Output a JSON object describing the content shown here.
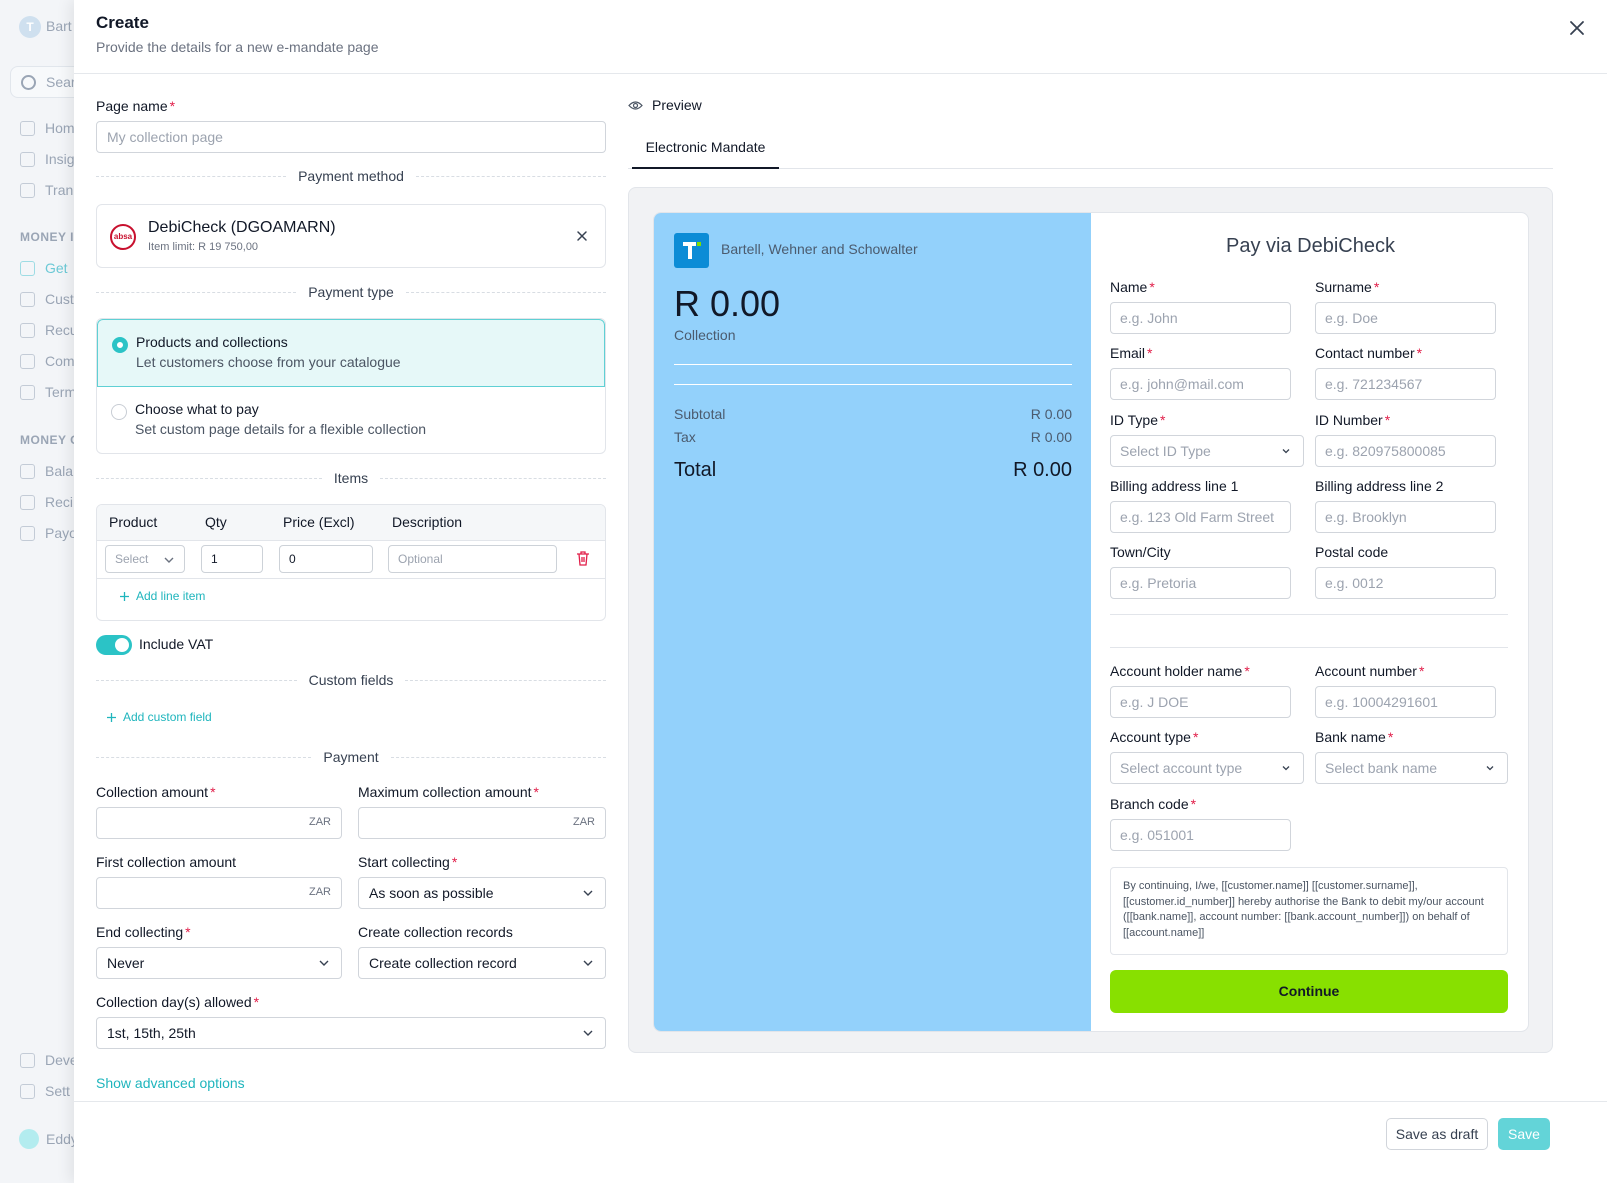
{
  "background": {
    "brand": "Bart",
    "search": "Sear",
    "items": [
      "Hom",
      "Insig",
      "Tran",
      "Get",
      "Cust",
      "Recu",
      "Com",
      "Term",
      "Bala",
      "Reci",
      "Payo",
      "Deve",
      "Sett"
    ],
    "sections": [
      "MONEY I",
      "MONEY O"
    ],
    "user": "Eddy"
  },
  "modal": {
    "title": "Create",
    "subtitle": "Provide the details for a new e-mandate page"
  },
  "form": {
    "page_name_label": "Page name",
    "page_name_placeholder": "My collection page",
    "payment_method_heading": "Payment method",
    "payment_method": {
      "logo_text": "absa",
      "name": "DebiCheck (DGOAMARN)",
      "limit": "Item limit: R 19 750,00"
    },
    "payment_type_heading": "Payment type",
    "payment_types": [
      {
        "title": "Products and collections",
        "desc": "Let customers choose from your catalogue",
        "selected": true
      },
      {
        "title": "Choose what to pay",
        "desc": "Set custom page details for a flexible collection",
        "selected": false
      }
    ],
    "items_heading": "Items",
    "items_columns": [
      "Product",
      "Qty",
      "Price (Excl)",
      "Description"
    ],
    "item_row": {
      "product": "Select",
      "qty": "1",
      "price": "0",
      "description": "Optional"
    },
    "add_line_item": "Add line item",
    "include_vat": "Include VAT",
    "custom_fields_heading": "Custom fields",
    "add_custom_field": "Add custom field",
    "payment_heading": "Payment",
    "collection_amount_label": "Collection amount",
    "max_collection_amount_label": "Maximum collection amount",
    "currency": "ZAR",
    "first_collection_amount_label": "First collection amount",
    "start_collecting_label": "Start collecting",
    "start_collecting_value": "As soon as possible",
    "end_collecting_label": "End collecting",
    "end_collecting_value": "Never",
    "create_records_label": "Create collection records",
    "create_records_value": "Create collection record",
    "collection_days_label": "Collection day(s) allowed",
    "collection_days_value": "1st, 15th, 25th",
    "advanced": "Show advanced options"
  },
  "preview": {
    "heading": "Preview",
    "tab": "Electronic Mandate",
    "merchant": "Bartell, Wehner and Schowalter",
    "amount": "R 0.00",
    "amount_caption": "Collection",
    "subtotal_label": "Subtotal",
    "subtotal": "R 0.00",
    "tax_label": "Tax",
    "tax": "R 0.00",
    "total_label": "Total",
    "total": "R 0.00",
    "pay_title": "Pay via DebiCheck",
    "fields": {
      "name": {
        "label": "Name",
        "ph": "e.g. John"
      },
      "surname": {
        "label": "Surname",
        "ph": "e.g. Doe"
      },
      "email": {
        "label": "Email",
        "ph": "e.g. john@mail.com"
      },
      "contact": {
        "label": "Contact number",
        "ph": "e.g. 721234567"
      },
      "id_type": {
        "label": "ID Type",
        "ph": "Select ID Type"
      },
      "id_number": {
        "label": "ID Number",
        "ph": "e.g. 820975800085"
      },
      "addr1": {
        "label": "Billing address line 1",
        "ph": "e.g. 123 Old Farm Street"
      },
      "addr2": {
        "label": "Billing address line 2",
        "ph": "e.g. Brooklyn"
      },
      "town": {
        "label": "Town/City",
        "ph": "e.g. Pretoria"
      },
      "postal": {
        "label": "Postal code",
        "ph": "e.g. 0012"
      },
      "holder": {
        "label": "Account holder name",
        "ph": "e.g. J DOE"
      },
      "account_number": {
        "label": "Account number",
        "ph": "e.g. 10004291601"
      },
      "account_type": {
        "label": "Account type",
        "ph": "Select account type"
      },
      "bank_name": {
        "label": "Bank name",
        "ph": "Select bank name"
      },
      "branch": {
        "label": "Branch code",
        "ph": "e.g. 051001"
      }
    },
    "consent": "By continuing, I/we, [[customer.name]] [[customer.surname]], [[customer.id_number]] hereby authorise the Bank to debit my/our account ([[bank.name]], account number: [[bank.account_number]]) on behalf of [[account.name]]",
    "continue": "Continue"
  },
  "footer": {
    "save_draft": "Save as draft",
    "save": "Save"
  },
  "colors": {
    "accent": "#2bc3c6",
    "preview_panel": "#93d1fb",
    "continue": "#88e000",
    "required": "#e11d48"
  }
}
